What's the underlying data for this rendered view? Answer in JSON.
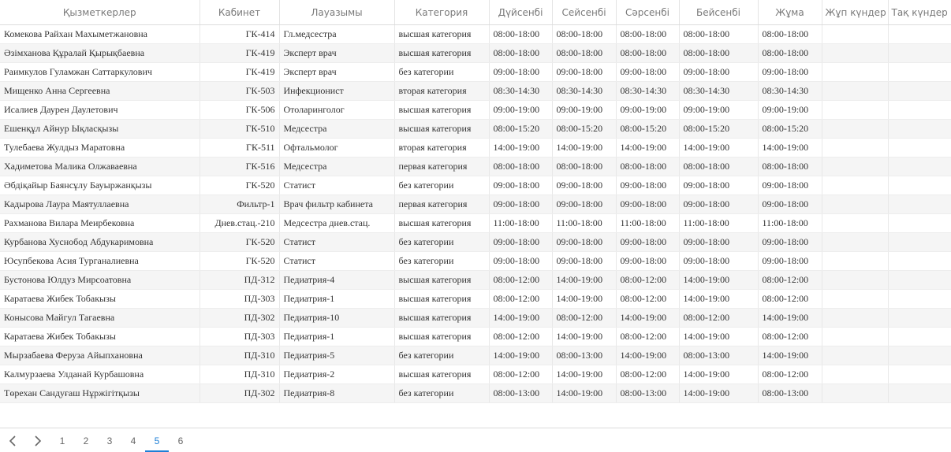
{
  "table": {
    "headers": [
      "Қызметкерлер",
      "Кабинет",
      "Лауазымы",
      "Категория",
      "Дүйсенбі",
      "Сейсенбі",
      "Сәрсенбі",
      "Бейсенбі",
      "Жұма",
      "Жұп күндер",
      "Тақ күндер"
    ],
    "rows": [
      [
        "Комекова Райхан Махыметжановна",
        "ГК-414",
        "Гл.медсестра",
        "высшая категория",
        "08:00-18:00",
        "08:00-18:00",
        "08:00-18:00",
        "08:00-18:00",
        "08:00-18:00",
        "",
        ""
      ],
      [
        "Әзімханова Құралай Қырықбаевна",
        "ГК-419",
        "Эксперт врач",
        "высшая категория",
        "08:00-18:00",
        "08:00-18:00",
        "08:00-18:00",
        "08:00-18:00",
        "08:00-18:00",
        "",
        ""
      ],
      [
        "Раимкулов Гуламжан Саттаркулович",
        "ГК-419",
        "Эксперт врач",
        "без категории",
        "09:00-18:00",
        "09:00-18:00",
        "09:00-18:00",
        "09:00-18:00",
        "09:00-18:00",
        "",
        ""
      ],
      [
        "Мищенко Анна Сергеевна",
        "ГК-503",
        "Инфекционист",
        "вторая категория",
        "08:30-14:30",
        "08:30-14:30",
        "08:30-14:30",
        "08:30-14:30",
        "08:30-14:30",
        "",
        ""
      ],
      [
        "Исалиев Даурен Даулетович",
        "ГК-506",
        "Отоларинголог",
        "высшая категория",
        "09:00-19:00",
        "09:00-19:00",
        "09:00-19:00",
        "09:00-19:00",
        "09:00-19:00",
        "",
        ""
      ],
      [
        "Ешенқұл Айнур Ықласқызы",
        "ГК-510",
        "Медсестра",
        "высшая категория",
        "08:00-15:20",
        "08:00-15:20",
        "08:00-15:20",
        "08:00-15:20",
        "08:00-15:20",
        "",
        ""
      ],
      [
        "Тулебаева Жулдыз Маратовна",
        "ГК-511",
        "Офтальмолог",
        "вторая категория",
        "14:00-19:00",
        "14:00-19:00",
        "14:00-19:00",
        "14:00-19:00",
        "14:00-19:00",
        "",
        ""
      ],
      [
        "Хадиметова Малика Олжаваевна",
        "ГК-516",
        "Медсестра",
        "первая категория",
        "08:00-18:00",
        "08:00-18:00",
        "08:00-18:00",
        "08:00-18:00",
        "08:00-18:00",
        "",
        ""
      ],
      [
        "Әбдіқайыр Баянсұлу Бауыржанқызы",
        "ГК-520",
        "Статист",
        "без категории",
        "09:00-18:00",
        "09:00-18:00",
        "09:00-18:00",
        "09:00-18:00",
        "09:00-18:00",
        "",
        ""
      ],
      [
        "Кадырова Лаура Маятуллаевна",
        "Фильтр-1",
        "Врач фильтр кабинета",
        "первая категория",
        "09:00-18:00",
        "09:00-18:00",
        "09:00-18:00",
        "09:00-18:00",
        "09:00-18:00",
        "",
        ""
      ],
      [
        "Рахманова Вилара Меирбековна",
        "Днев.стац.-210",
        "Медсестра днев.стац.",
        "высшая категория",
        "11:00-18:00",
        "11:00-18:00",
        "11:00-18:00",
        "11:00-18:00",
        "11:00-18:00",
        "",
        ""
      ],
      [
        "Курбанова Хуснобод Абдукаримовна",
        "ГК-520",
        "Статист",
        "без категории",
        "09:00-18:00",
        "09:00-18:00",
        "09:00-18:00",
        "09:00-18:00",
        "09:00-18:00",
        "",
        ""
      ],
      [
        "Юсупбекова Асия Турганалиевна",
        "ГК-520",
        "Статист",
        "без категории",
        "09:00-18:00",
        "09:00-18:00",
        "09:00-18:00",
        "09:00-18:00",
        "09:00-18:00",
        "",
        ""
      ],
      [
        "Бустонова Юлдуз Мирсоатовна",
        "ПД-312",
        "Педиатрия-4",
        "высшая категория",
        "08:00-12:00",
        "14:00-19:00",
        "08:00-12:00",
        "14:00-19:00",
        "08:00-12:00",
        "",
        ""
      ],
      [
        "Каратаева Жибек Тобакызы",
        "ПД-303",
        "Педиатрия-1",
        "высшая категория",
        "08:00-12:00",
        "14:00-19:00",
        "08:00-12:00",
        "14:00-19:00",
        "08:00-12:00",
        "",
        ""
      ],
      [
        "Конысова Майгул Тагаевна",
        "ПД-302",
        "Педиатрия-10",
        "высшая категория",
        "14:00-19:00",
        "08:00-12:00",
        "14:00-19:00",
        "08:00-12:00",
        "14:00-19:00",
        "",
        ""
      ],
      [
        "Каратаева Жибек Тобакызы",
        "ПД-303",
        "Педиатрия-1",
        "высшая категория",
        "08:00-12:00",
        "14:00-19:00",
        "08:00-12:00",
        "14:00-19:00",
        "08:00-12:00",
        "",
        ""
      ],
      [
        "Мырзабаева Феруза Айыпхановна",
        "ПД-310",
        "Педиатрия-5",
        "без категории",
        "14:00-19:00",
        "08:00-13:00",
        "14:00-19:00",
        "08:00-13:00",
        "14:00-19:00",
        "",
        ""
      ],
      [
        "Калмурзаева Улданай Курбашовна",
        "ПД-310",
        "Педиатрия-2",
        "высшая категория",
        "08:00-12:00",
        "14:00-19:00",
        "08:00-12:00",
        "14:00-19:00",
        "08:00-12:00",
        "",
        ""
      ],
      [
        "Төрехан Сандуғаш Нұржігітқызы",
        "ПД-302",
        "Педиатрия-8",
        "без категории",
        "08:00-13:00",
        "14:00-19:00",
        "08:00-13:00",
        "14:00-19:00",
        "08:00-13:00",
        "",
        ""
      ]
    ]
  },
  "pagination": {
    "pages": [
      "1",
      "2",
      "3",
      "4",
      "5",
      "6"
    ],
    "current": "5",
    "prev_icon": "chevron-left-icon",
    "next_icon": "chevron-right-icon"
  },
  "colors": {
    "accent": "#1e7fd6",
    "row_alt": "#f5f5f5"
  }
}
